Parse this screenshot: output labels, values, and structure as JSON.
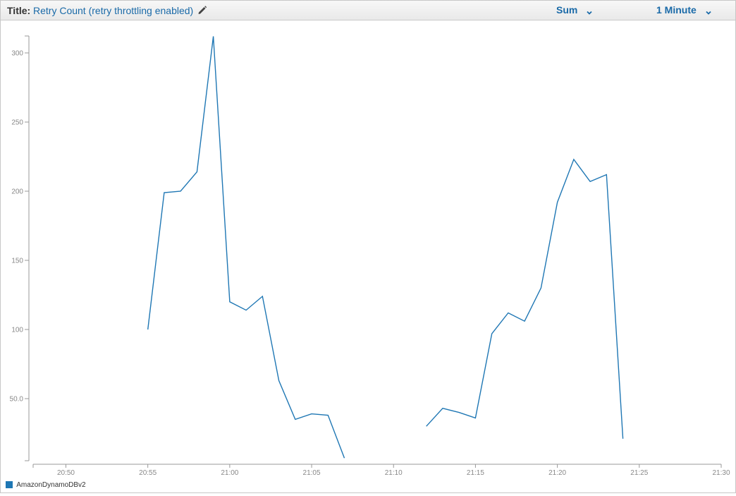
{
  "toolbar": {
    "title_label": "Title:",
    "title_text": "Retry Count (retry throttling enabled)",
    "edit_icon": "pencil-icon",
    "statistic": "Sum",
    "period": "1 Minute",
    "dropdown_icon": "chevron-down-icon"
  },
  "colors": {
    "series": "#1f77b4",
    "axis": "#999999",
    "link": "#1a6aa8"
  },
  "chart_data": {
    "type": "line",
    "title": "Retry Count (retry throttling enabled)",
    "xlabel": "",
    "ylabel": "",
    "x_unit": "minute",
    "xlim": [
      "20:48",
      "21:30"
    ],
    "ylim": [
      3,
      315
    ],
    "x_ticks": [
      "20:50",
      "20:55",
      "21:00",
      "21:05",
      "21:10",
      "21:15",
      "21:20",
      "21:25",
      "21:30"
    ],
    "y_ticks": [
      "300",
      "250",
      "200",
      "150",
      "100",
      "50.0"
    ],
    "y_tick_values": [
      300,
      250,
      200,
      150,
      100,
      50
    ],
    "grid": false,
    "legend_position": "bottom-left",
    "series": [
      {
        "name": "AmazonDynamoDBv2",
        "color": "#1f77b4",
        "x": [
          "20:55",
          "20:56",
          "20:57",
          "20:58",
          "20:59",
          "21:00",
          "21:01",
          "21:02",
          "21:03",
          "21:04",
          "21:05",
          "21:06",
          "21:07",
          "21:08",
          "21:09",
          "21:10",
          "21:11",
          "21:12",
          "21:13",
          "21:14",
          "21:15",
          "21:16",
          "21:17",
          "21:18",
          "21:19",
          "21:20",
          "21:21",
          "21:22",
          "21:23",
          "21:24"
        ],
        "values": [
          100,
          199,
          200,
          214,
          312,
          120,
          114,
          124,
          63,
          35,
          39,
          38,
          7,
          null,
          null,
          null,
          null,
          30,
          43,
          40,
          36,
          97,
          112,
          106,
          130,
          192,
          223,
          207,
          212,
          21
        ]
      }
    ]
  }
}
